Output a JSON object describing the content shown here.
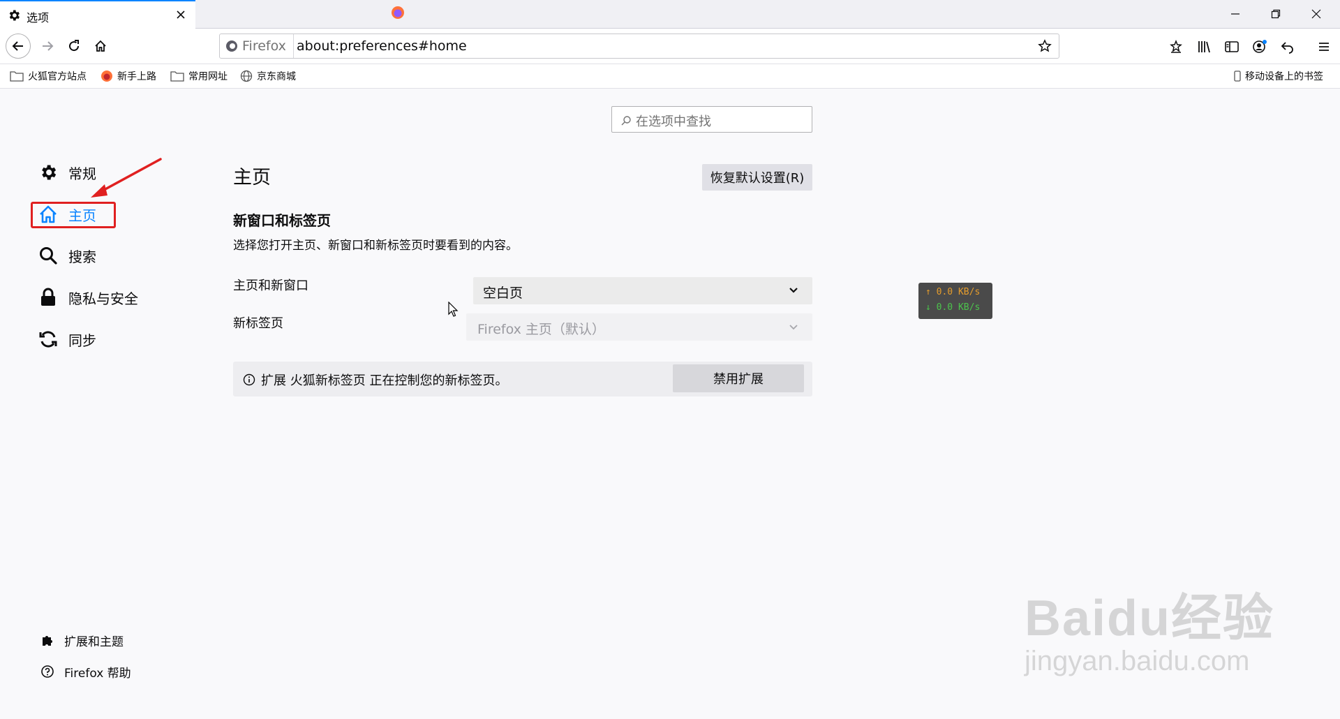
{
  "tab": {
    "title": "选项"
  },
  "navbar": {
    "identity_label": "Firefox",
    "url": "about:preferences#home"
  },
  "bookmarks": {
    "items": [
      {
        "label": "火狐官方站点",
        "icon": "folder-icon"
      },
      {
        "label": "新手上路",
        "icon": "firefox-icon"
      },
      {
        "label": "常用网址",
        "icon": "folder-icon"
      },
      {
        "label": "京东商城",
        "icon": "globe-icon"
      }
    ],
    "mobile": "移动设备上的书签"
  },
  "search": {
    "placeholder": "在选项中查找"
  },
  "sidebar": {
    "categories": [
      {
        "label": "常规",
        "icon": "gear-icon"
      },
      {
        "label": "主页",
        "icon": "home-icon",
        "selected": true
      },
      {
        "label": "搜索",
        "icon": "search-icon"
      },
      {
        "label": "隐私与安全",
        "icon": "lock-icon"
      },
      {
        "label": "同步",
        "icon": "sync-icon"
      }
    ],
    "footer": [
      {
        "label": "扩展和主题",
        "icon": "puzzle-icon"
      },
      {
        "label": "Firefox 帮助",
        "icon": "help-icon"
      }
    ]
  },
  "main": {
    "title": "主页",
    "restore_button": "恢复默认设置(R)",
    "section_title": "新窗口和标签页",
    "section_desc": "选择您打开主页、新窗口和新标签页时要看到的内容。",
    "homepage_label": "主页和新窗口",
    "homepage_value": "空白页",
    "newtab_label": "新标签页",
    "newtab_value": "Firefox 主页（默认）",
    "ext_notice": "扩展 火狐新标签页 正在控制您的新标签页。",
    "disable_ext_button": "禁用扩展"
  },
  "speed_widget": {
    "up": "↑ 0.0 KB/s",
    "down": "↓ 0.0 KB/s"
  },
  "watermark": {
    "main": "Baidu经验",
    "sub": "jingyan.baidu.com"
  },
  "colors": {
    "accent": "#0a84ff",
    "annotation": "#e02020"
  }
}
